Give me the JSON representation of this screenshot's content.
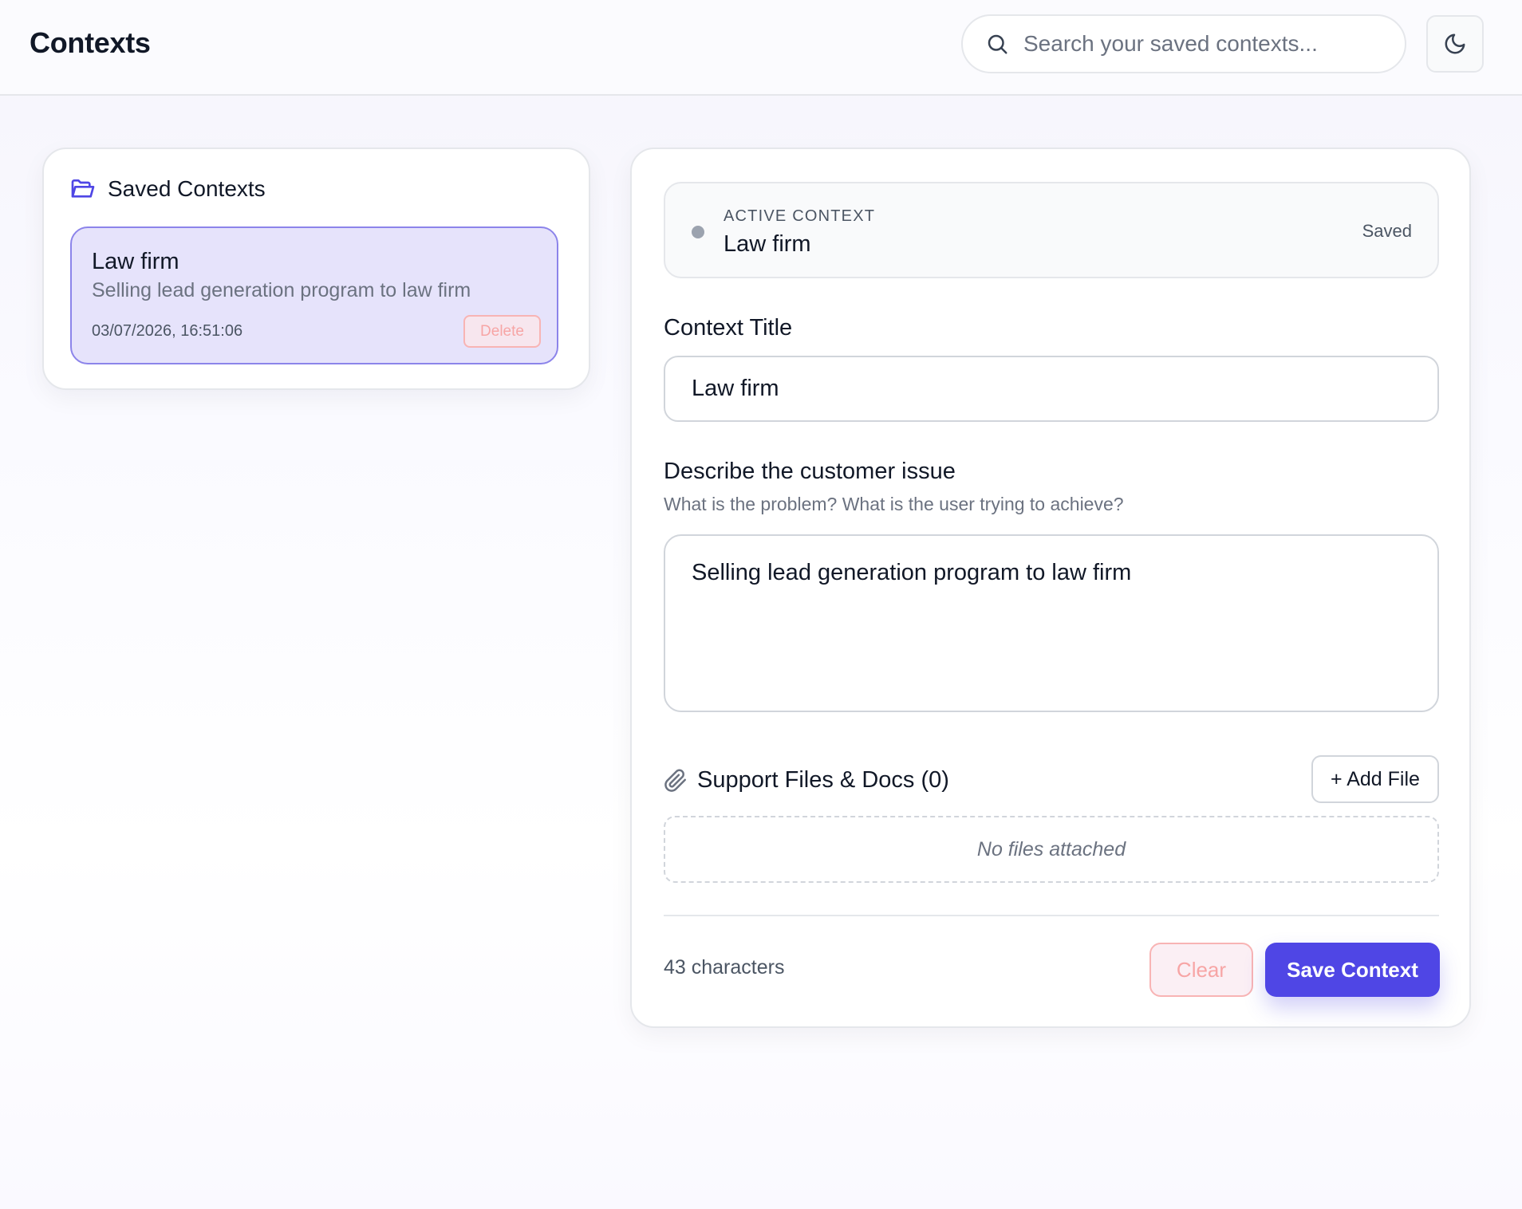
{
  "header": {
    "title": "Contexts",
    "search_placeholder": "Search your saved contexts...",
    "search_icon": "search-icon",
    "theme_toggle_icon": "moon-icon"
  },
  "saved_panel": {
    "heading": "Saved Contexts",
    "heading_icon": "folder-open-icon",
    "items": [
      {
        "title": "Law firm",
        "description": "Selling lead generation program to law firm",
        "timestamp": "03/07/2026, 16:51:06",
        "delete_label": "Delete"
      }
    ]
  },
  "editor": {
    "active_context": {
      "kicker": "ACTIVE CONTEXT",
      "name": "Law firm",
      "status": "Saved"
    },
    "title_field": {
      "label": "Context Title",
      "value": "Law firm"
    },
    "issue_field": {
      "label": "Describe the customer issue",
      "help": "What is the problem? What is the user trying to achieve?",
      "value": "Selling lead generation program to law firm"
    },
    "files": {
      "label": "Support Files & Docs (0)",
      "icon": "paperclip-icon",
      "add_label": "+ Add File",
      "empty_text": "No files attached"
    },
    "footer": {
      "char_count": "43 characters",
      "clear_label": "Clear",
      "save_label": "Save Context"
    }
  },
  "colors": {
    "accent": "#4f46e5",
    "selected_bg": "#e6e3fb",
    "danger": "#f7a5a5"
  }
}
